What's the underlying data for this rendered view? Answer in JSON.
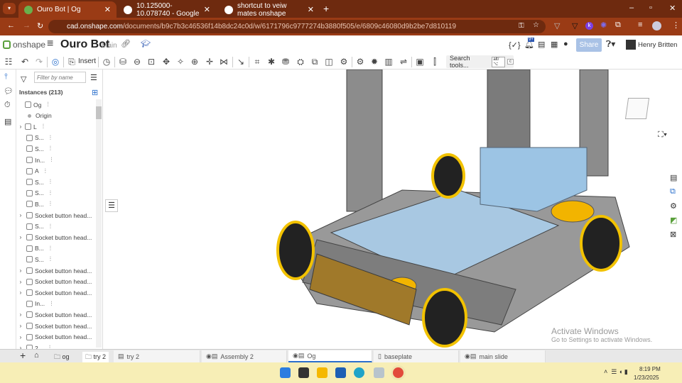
{
  "browser": {
    "tabs": [
      {
        "title": "Ouro Bot | Og",
        "active": true
      },
      {
        "title": "10.125000-10.078740 - Google"
      },
      {
        "title": "shortcut to veiw mates onshape"
      }
    ],
    "url_host": "cad.onshape.com",
    "url_path": "/documents/b9c7b3c46536f14b8dc24c0d/w/6171796c9777274b3880f505/e/6809c46080d9b2be7d810119"
  },
  "header": {
    "logo": "onshape",
    "doc_title": "Ouro Bot",
    "branch": "Main",
    "notif_badge": "9+",
    "share": "Share",
    "user": "Henry Britten"
  },
  "toolbar": {
    "insert": "Insert",
    "search": "Search tools...",
    "kbd1": "alt/⌥",
    "kbd2": "c"
  },
  "tree": {
    "filter_placeholder": "Filter by name",
    "instances": "Instances (213)",
    "items": [
      {
        "label": "Og",
        "indent": 0,
        "chev": false
      },
      {
        "label": "Origin",
        "indent": 1,
        "chev": false
      },
      {
        "label": "L",
        "indent": 0,
        "chev": true
      },
      {
        "label": "S...",
        "indent": 1
      },
      {
        "label": "S...",
        "indent": 1
      },
      {
        "label": "In...",
        "indent": 1
      },
      {
        "label": "A",
        "indent": 1
      },
      {
        "label": "S...",
        "indent": 1
      },
      {
        "label": "S...",
        "indent": 1
      },
      {
        "label": "B...",
        "indent": 1
      },
      {
        "label": "Socket button head...",
        "indent": 1,
        "chev": true
      },
      {
        "label": "S...",
        "indent": 1
      },
      {
        "label": "Socket button head...",
        "indent": 1,
        "chev": true
      },
      {
        "label": "B...",
        "indent": 1
      },
      {
        "label": "S...",
        "indent": 1
      },
      {
        "label": "Socket button head...",
        "indent": 1,
        "chev": true
      },
      {
        "label": "Socket button head...",
        "indent": 1,
        "chev": true
      },
      {
        "label": "Socket button head...",
        "indent": 1,
        "chev": true
      },
      {
        "label": "In...",
        "indent": 1
      },
      {
        "label": "Socket button head...",
        "indent": 1,
        "chev": true
      },
      {
        "label": "Socket button head...",
        "indent": 1,
        "chev": true
      },
      {
        "label": "Socket button head...",
        "indent": 1,
        "chev": true
      },
      {
        "label": "2...",
        "indent": 1,
        "chev": true
      }
    ]
  },
  "bottom": {
    "breadcrumbs": [
      "og",
      "try 2"
    ],
    "tabs": [
      "try 2",
      "Assembly 2",
      "Og",
      "baseplate",
      "main slide"
    ],
    "active": "Og"
  },
  "watermark": {
    "title": "Activate Windows",
    "sub": "Go to Settings to activate Windows."
  },
  "taskbar": {
    "time": "8:19 PM",
    "date": "1/23/2025"
  },
  "colors": {
    "accent": "#2a6fcc",
    "wheel": "#f2c200",
    "box": "#9cc4e4",
    "frame": "#8a8a8a"
  }
}
